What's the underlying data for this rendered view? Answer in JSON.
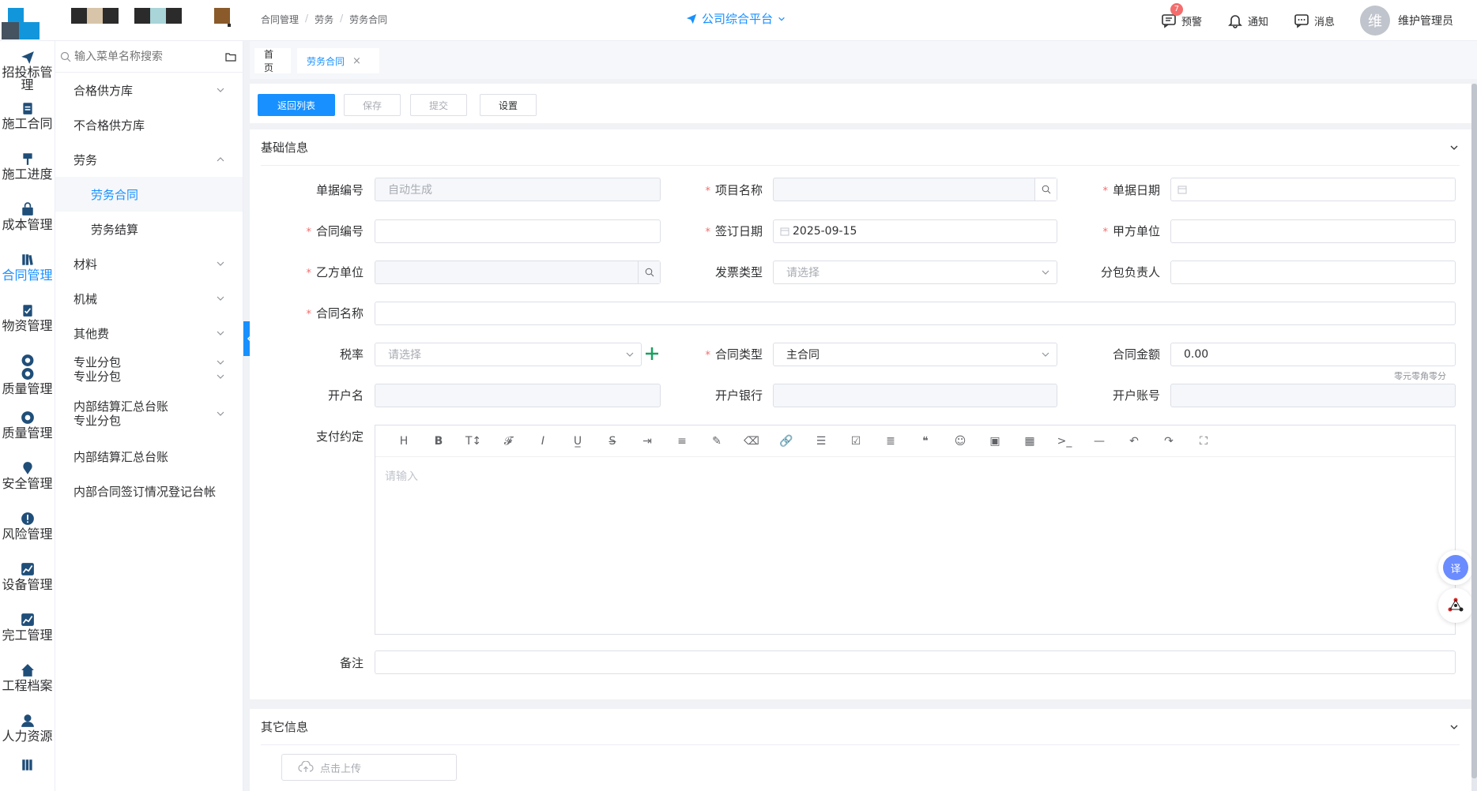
{
  "colors": {
    "primary": "#1890ff",
    "danger": "#f56c6c",
    "success": "#19a15f"
  },
  "header": {
    "breadcrumb": [
      "合同管理",
      "劳务",
      "劳务合同"
    ],
    "platform": "公司综合平台",
    "actions": [
      {
        "label": "预警",
        "icon": "alert-message-icon",
        "badge": "7"
      },
      {
        "label": "通知",
        "icon": "bell-icon"
      },
      {
        "label": "消息",
        "icon": "chat-icon"
      }
    ],
    "avatar_text": "维",
    "username": "维护管理员"
  },
  "leftnav": [
    {
      "label": "招投标管理",
      "icon": "paper-plane-icon"
    },
    {
      "label": "施工合同",
      "icon": "clipboard-icon"
    },
    {
      "label": "施工进度",
      "icon": "hammer-icon"
    },
    {
      "label": "成本管理",
      "icon": "bag-icon"
    },
    {
      "label": "合同管理",
      "icon": "books-icon",
      "active": true
    },
    {
      "label": "物资管理",
      "icon": "clipboard-check-icon"
    },
    {
      "label": "质量管理",
      "icon": "recycle-icon"
    },
    {
      "label": "质量管理",
      "icon": "recycle-icon"
    },
    {
      "label": "安全管理",
      "icon": "pin-icon"
    },
    {
      "label": "风险管理",
      "icon": "warning-circle-icon"
    },
    {
      "label": "设备管理",
      "icon": "chart-icon"
    },
    {
      "label": "完工管理",
      "icon": "chart-icon"
    },
    {
      "label": "工程档案",
      "icon": "home-icon"
    },
    {
      "label": "人力资源",
      "icon": "user-icon"
    }
  ],
  "submenu": {
    "search_placeholder": "输入菜单名称搜索",
    "items": [
      {
        "label": "合格供方库",
        "chevron": "down"
      },
      {
        "label": "不合格供方库"
      },
      {
        "label": "劳务",
        "chevron": "up"
      },
      {
        "label": "劳务合同",
        "child": true,
        "active": true
      },
      {
        "label": "劳务结算",
        "child": true
      },
      {
        "label": "材料",
        "chevron": "down"
      },
      {
        "label": "机械",
        "chevron": "down"
      },
      {
        "label": "其他费",
        "chevron": "down"
      },
      {
        "label": "专业分包",
        "label2": "专业分包",
        "chevron": "down",
        "tall": true
      },
      {
        "label": "内部结算汇总台账",
        "label2": "专业分包",
        "chevron": "down",
        "tall": true
      },
      {
        "label": "内部结算汇总台账"
      },
      {
        "label": "内部合同签订情况登记台帐"
      }
    ]
  },
  "tabs": [
    {
      "label": "首页"
    },
    {
      "label": "劳务合同",
      "active": true,
      "close": "×"
    }
  ],
  "toolbar": {
    "back": "返回列表",
    "save": "保存",
    "submit": "提交",
    "settings": "设置"
  },
  "basic": {
    "title": "基础信息",
    "fields": {
      "doc_no": {
        "label": "单据编号",
        "placeholder": "自动生成"
      },
      "project": {
        "label": "项目名称",
        "value": ""
      },
      "doc_date": {
        "label": "单据日期",
        "value": ""
      },
      "contract_no": {
        "label": "合同编号",
        "value": ""
      },
      "sign_date": {
        "label": "签订日期",
        "value": "2025-09-15"
      },
      "party_a": {
        "label": "甲方单位",
        "value": ""
      },
      "party_b": {
        "label": "乙方单位",
        "value": ""
      },
      "invoice_type": {
        "label": "发票类型",
        "placeholder": "请选择"
      },
      "sub_lead": {
        "label": "分包负责人",
        "value": ""
      },
      "contract_name": {
        "label": "合同名称",
        "value": ""
      },
      "tax_rate": {
        "label": "税率",
        "placeholder": "请选择"
      },
      "contract_type": {
        "label": "合同类型",
        "value": "主合同"
      },
      "amount": {
        "label": "合同金额",
        "value": "0.00",
        "hint": "零元零角零分"
      },
      "account_name": {
        "label": "开户名",
        "value": ""
      },
      "bank": {
        "label": "开户银行",
        "value": ""
      },
      "account_no": {
        "label": "开户账号",
        "value": ""
      },
      "payment": {
        "label": "支付约定",
        "placeholder": "请输入"
      },
      "remark": {
        "label": "备注",
        "value": ""
      }
    }
  },
  "editor_tools": [
    "heading-icon",
    "bold-icon",
    "font-size-icon",
    "font-family-icon",
    "italic-icon",
    "underline-icon",
    "strikethrough-icon",
    "indent-icon",
    "line-height-icon",
    "highlight-icon",
    "eraser-icon",
    "link-icon",
    "bullet-list-icon",
    "todo-icon",
    "align-icon",
    "quote-icon",
    "emoji-icon",
    "image-icon",
    "table-icon",
    "code-icon",
    "divider-icon",
    "undo-icon",
    "redo-icon",
    "fullscreen-icon"
  ],
  "other": {
    "title": "其它信息",
    "upload": "点击上传"
  },
  "float": {
    "translate": "译"
  }
}
